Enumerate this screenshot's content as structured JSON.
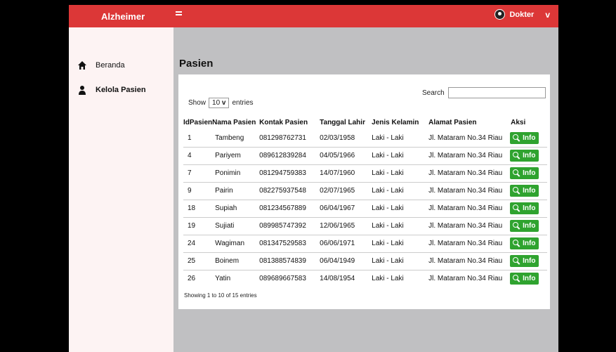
{
  "app": {
    "brand": "Alzheimer",
    "user_label": "Dokter",
    "caret": "v"
  },
  "sidebar": {
    "items": [
      {
        "label": "Beranda",
        "icon": "home-icon"
      },
      {
        "label": "Kelola Pasien",
        "icon": "user-icon"
      }
    ]
  },
  "page": {
    "title": "Pasien"
  },
  "table_controls": {
    "show_label": "Show",
    "entries_value": "10",
    "entries_label": "entries",
    "search_label": "Search",
    "search_value": ""
  },
  "table": {
    "headers": [
      "IdPasien",
      "Nama Pasien",
      "Kontak Pasien",
      "Tanggal Lahir",
      "Jenis Kelamin",
      "Alamat Pasien",
      "Aksi"
    ],
    "rows": [
      {
        "id": "1",
        "nama": "Tambeng",
        "kontak": "081298762731",
        "tgl": "02/03/1958",
        "jk": "Laki - Laki",
        "alamat": "Jl. Mataram No.34 Riau",
        "aksi": "Info"
      },
      {
        "id": "4",
        "nama": "Pariyem",
        "kontak": "089612839284",
        "tgl": "04/05/1966",
        "jk": "Laki - Laki",
        "alamat": "Jl. Mataram No.34 Riau",
        "aksi": "Info"
      },
      {
        "id": "7",
        "nama": "Ponimin",
        "kontak": "081294759383",
        "tgl": "14/07/1960",
        "jk": "Laki - Laki",
        "alamat": "Jl. Mataram No.34 Riau",
        "aksi": "Info"
      },
      {
        "id": "9",
        "nama": "Pairin",
        "kontak": "082275937548",
        "tgl": "02/07/1965",
        "jk": "Laki - Laki",
        "alamat": "Jl. Mataram No.34 Riau",
        "aksi": "Info"
      },
      {
        "id": "18",
        "nama": "Supiah",
        "kontak": "081234567889",
        "tgl": "06/04/1967",
        "jk": "Laki - Laki",
        "alamat": "Jl. Mataram No.34 Riau",
        "aksi": "Info"
      },
      {
        "id": "19",
        "nama": "Sujiati",
        "kontak": "089985747392",
        "tgl": "12/06/1965",
        "jk": "Laki - Laki",
        "alamat": "Jl. Mataram No.34 Riau",
        "aksi": "Info"
      },
      {
        "id": "24",
        "nama": "Wagiman",
        "kontak": "081347529583",
        "tgl": "06/06/1971",
        "jk": "Laki - Laki",
        "alamat": "Jl. Mataram No.34 Riau",
        "aksi": "Info"
      },
      {
        "id": "25",
        "nama": "Boinem",
        "kontak": "081388574839",
        "tgl": "06/04/1949",
        "jk": "Laki - Laki",
        "alamat": "Jl. Mataram No.34 Riau",
        "aksi": "Info"
      },
      {
        "id": "26",
        "nama": "Yatin",
        "kontak": "089689667583",
        "tgl": "14/08/1954",
        "jk": "Laki - Laki",
        "alamat": "Jl. Mataram No.34 Riau",
        "aksi": "Info"
      }
    ],
    "footer": "Showing 1 to 10 of 15 entries"
  },
  "colors": {
    "topbar": "#dc3737",
    "info_button": "#2fa32f",
    "sidebar_bg": "#fdf3f3",
    "content_bg": "#c0c0c2"
  }
}
